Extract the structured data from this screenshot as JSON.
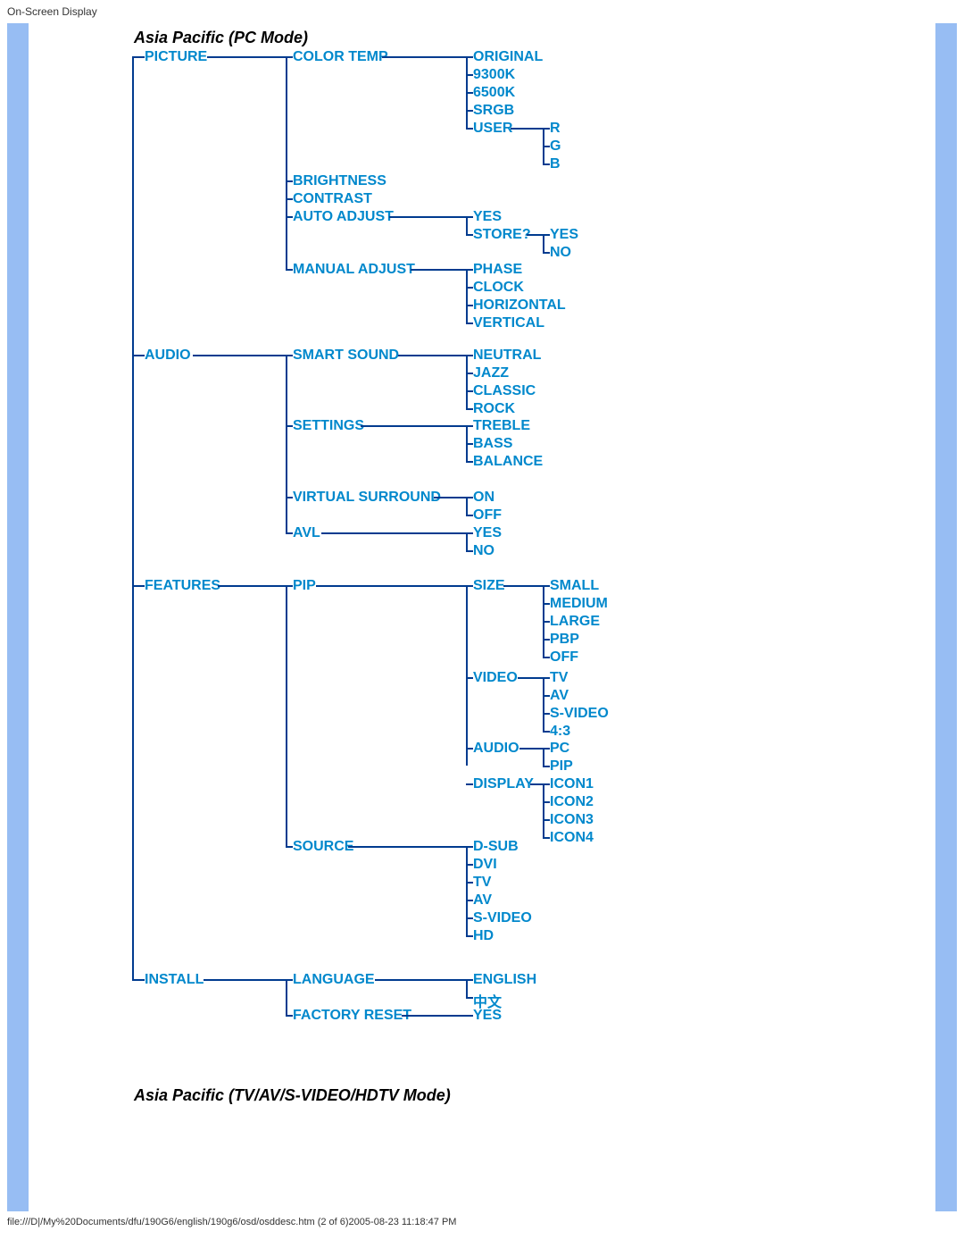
{
  "header": "On-Screen Display",
  "footer": "file:///D|/My%20Documents/dfu/190G6/english/190g6/osd/osddesc.htm (2 of 6)2005-08-23 11:18:47 PM",
  "titles": {
    "t1": "Asia Pacific (PC Mode)",
    "t2": "Asia Pacific (TV/AV/S-VIDEO/HDTV Mode)"
  },
  "n": {
    "picture": "PICTURE",
    "colortemp": "COLOR TEMP",
    "original": "ORIGINAL",
    "9300": "9300K",
    "6500": "6500K",
    "srgb": "SRGB",
    "user": "USER",
    "r": "R",
    "g": "G",
    "b": "B",
    "brightness": "BRIGHTNESS",
    "contrast": "CONTRAST",
    "autoadj": "AUTO ADJUST",
    "yes1": "YES",
    "store": "STORE?",
    "yes2": "YES",
    "no1": "NO",
    "manadj": "MANUAL ADJUST",
    "phase": "PHASE",
    "clock": "CLOCK",
    "horiz": "HORIZONTAL",
    "vert": "VERTICAL",
    "audio": "AUDIO",
    "smartsnd": "SMART SOUND",
    "neutral": "NEUTRAL",
    "jazz": "JAZZ",
    "classic": "CLASSIC",
    "rock": "ROCK",
    "settings": "SETTINGS",
    "treble": "TREBLE",
    "bass": "BASS",
    "balance": "BALANCE",
    "vsurr": "VIRTUAL SURROUND",
    "on": "ON",
    "off": "OFF",
    "avl": "AVL",
    "yes3": "YES",
    "no2": "NO",
    "features": "FEATURES",
    "pip": "PIP",
    "size": "SIZE",
    "small": "SMALL",
    "medium": "MEDIUM",
    "large": "LARGE",
    "pbp": "PBP",
    "off2": "OFF",
    "video": "VIDEO",
    "tv": "TV",
    "av": "AV",
    "svideo": "S-VIDEO",
    "s43": "4:3",
    "audio2": "AUDIO",
    "pc": "PC",
    "pip2": "PIP",
    "display": "DISPLAY",
    "icon1": "ICON1",
    "icon2": "ICON2",
    "icon3": "ICON3",
    "icon4": "ICON4",
    "source": "SOURCE",
    "dsub": "D-SUB",
    "dvi": "DVI",
    "tv2": "TV",
    "av2": "AV",
    "svideo2": "S-VIDEO",
    "hd": "HD",
    "install": "INSTALL",
    "language": "LANGUAGE",
    "english": "ENGLISH",
    "chinese": "中文",
    "freset": "FACTORY RESET",
    "yes4": "YES"
  }
}
